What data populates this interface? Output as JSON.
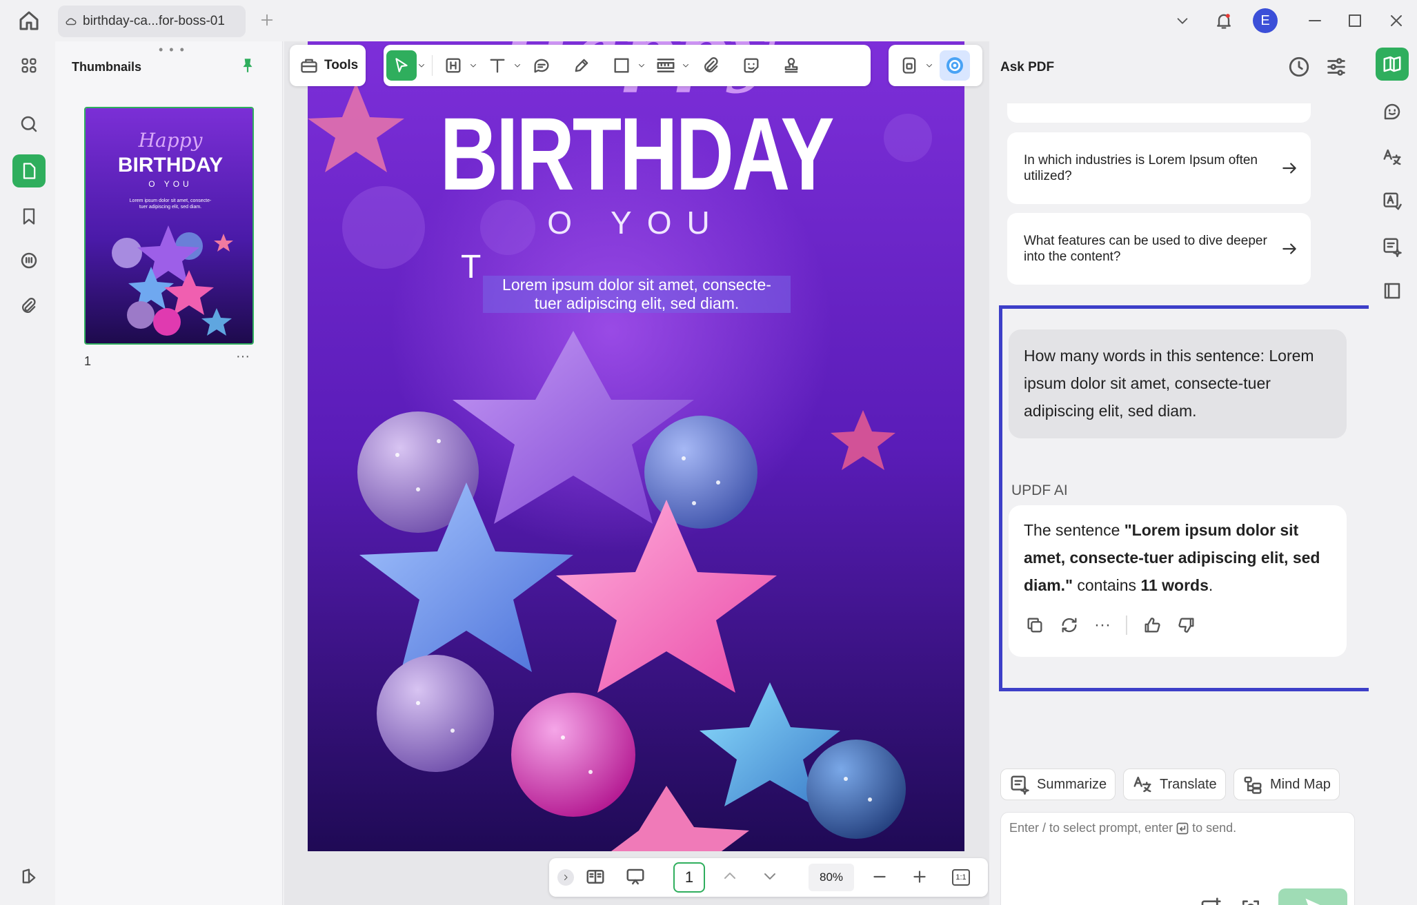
{
  "tab": {
    "title": "birthday-ca...for-boss-01"
  },
  "user": {
    "initial": "E"
  },
  "thumbnails": {
    "title": "Thumbnails",
    "page_number": "1"
  },
  "toolbar": {
    "tools_label": "Tools"
  },
  "document": {
    "script_text": "Happy",
    "headline": "BIRTHDAY",
    "subline": "O YOU",
    "cursor_glyph": "T",
    "body_line1": "Lorem ipsum dolor sit amet, consecte-",
    "body_line2": "tuer adipiscing elit, sed diam."
  },
  "thumb_preview": {
    "script_text": "Happy",
    "headline": "BIRTHDAY",
    "subline": "O YOU",
    "body": "Lorem ipsum dolor sit amet, consecte- tuer adipiscing elit, sed diam."
  },
  "bottom_nav": {
    "page": "1",
    "zoom": "80%",
    "fit_label": "1:1"
  },
  "ask_pdf": {
    "title": "Ask PDF",
    "suggestions": [
      "In which industries is Lorem Ipsum often utilized?",
      "What features can be used to dive deeper into the content?"
    ],
    "user_message": "How many words in this sentence: Lorem ipsum dolor sit amet, consecte-tuer adipiscing elit, sed diam.",
    "ai_label": "UPDF AI",
    "ai_reply": {
      "prefix": "The sentence ",
      "quote": "\"Lorem ipsum dolor sit amet, consecte-tuer adipiscing elit, sed diam.\"",
      "middle": " contains ",
      "count": "11 words",
      "suffix": "."
    },
    "chips": [
      "Summarize",
      "Translate",
      "Mind Map"
    ],
    "prompt_placeholder_a": "Enter / to select prompt, enter",
    "prompt_placeholder_b": "to send."
  },
  "colors": {
    "accent": "#2fae5d",
    "highlight": "#3d3fc8",
    "avatar": "#3b4fd8"
  }
}
